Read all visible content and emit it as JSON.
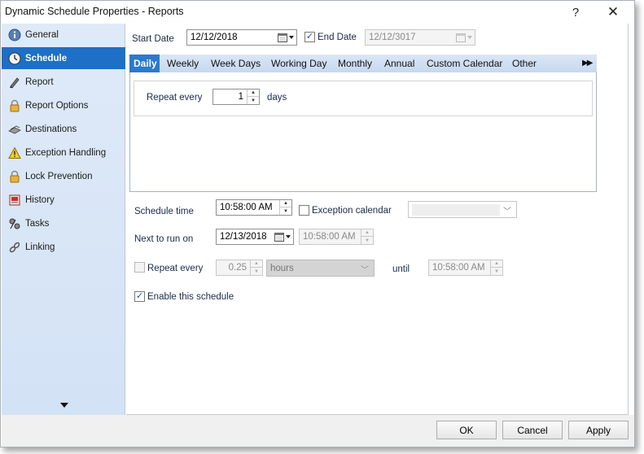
{
  "window": {
    "title": "Dynamic Schedule Properties - Reports",
    "help": "?",
    "close": "✕"
  },
  "sidebar": {
    "items": [
      {
        "label": "General",
        "icon": "info-icon"
      },
      {
        "label": "Schedule",
        "icon": "clock-icon"
      },
      {
        "label": "Report",
        "icon": "pen-icon"
      },
      {
        "label": "Report Options",
        "icon": "lock-icon"
      },
      {
        "label": "Destinations",
        "icon": "destinations-icon"
      },
      {
        "label": "Exception Handling",
        "icon": "warning-icon"
      },
      {
        "label": "Lock Prevention",
        "icon": "lock-icon"
      },
      {
        "label": "History",
        "icon": "history-icon"
      },
      {
        "label": "Tasks",
        "icon": "tasks-icon"
      },
      {
        "label": "Linking",
        "icon": "link-icon"
      }
    ],
    "active_index": 1
  },
  "schedule": {
    "start_date_label": "Start Date",
    "start_date": "12/12/2018",
    "end_date_label": "End Date",
    "end_date": "12/12/3017",
    "end_date_checked": true,
    "tabs": [
      "Daily",
      "Weekly",
      "Week Days",
      "Working Day",
      "Monthly",
      "Annual",
      "Custom Calendar",
      "Other"
    ],
    "active_tab": "Daily",
    "tabs_more": "▶▶",
    "repeat_every_label": "Repeat every",
    "repeat_every_value": "1",
    "repeat_every_unit": "days",
    "schedule_time_label": "Schedule time",
    "schedule_time": "10:58:00 AM",
    "exception_calendar_label": "Exception calendar",
    "exception_calendar_checked": false,
    "exception_calendar_value": "",
    "next_to_run_label": "Next to run on",
    "next_to_run_date": "12/13/2018",
    "next_to_run_time": "10:58:00 AM",
    "repeat_label": "Repeat every",
    "repeat_checked": false,
    "repeat_interval": "0.25",
    "repeat_unit": "hours",
    "until_label": "until",
    "until_time": "10:58:00 AM",
    "enable_label": "Enable this schedule",
    "enable_checked": true
  },
  "buttons": {
    "ok": "OK",
    "cancel": "Cancel",
    "apply": "Apply"
  }
}
